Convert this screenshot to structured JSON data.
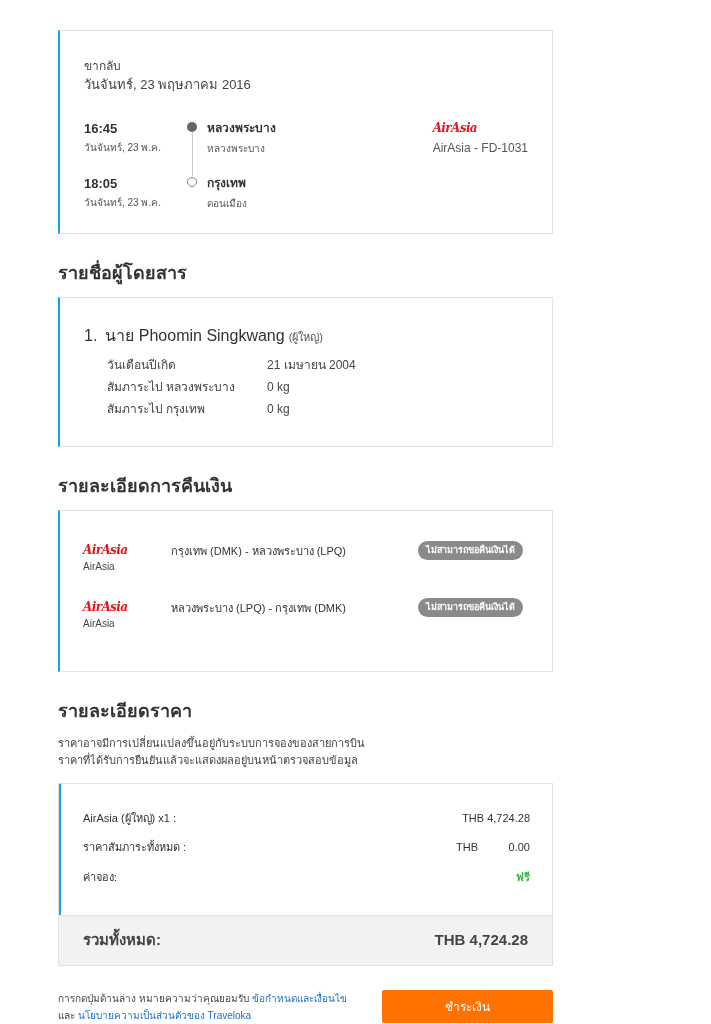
{
  "flight": {
    "direction": "ขากลับ",
    "date": "วันจันทร์, 23 พฤษภาคม 2016",
    "stops": [
      {
        "kind": "departure",
        "time": "16:45",
        "date": "วันจันทร์, 23 พ.ค.",
        "city": "หลวงพระบาง",
        "airport": "หลวงพระบาง"
      },
      {
        "kind": "arrival",
        "time": "18:05",
        "date": "วันจันทร์, 23 พ.ค.",
        "city": "กรุงเทพ",
        "airport": "ดอนเมือง"
      }
    ],
    "airline_logo": "AirAsia",
    "airline": "AirAsia - FD-1031"
  },
  "passengers": {
    "heading": "รายชื่อผู้โดยสาร",
    "items": [
      {
        "number": "1.",
        "name": "นาย Phoomin Singkwang",
        "type": "(ผู้ใหญ่)",
        "details": [
          {
            "label": "วันเดือนปีเกิด",
            "value": "21 เมษายน 2004"
          },
          {
            "label": "สัมภาระไป หลวงพระบาง",
            "value": "0 kg"
          },
          {
            "label": "สัมภาระไป กรุงเทพ",
            "value": "0 kg"
          }
        ]
      }
    ]
  },
  "refund": {
    "heading": "รายละเอียดการคืนเงิน",
    "items": [
      {
        "logo": "AirAsia",
        "airline": "AirAsia",
        "route": "กรุงเทพ (DMK) - หลวงพระบาง (LPQ)",
        "status": "ไม่สามารถขอคืนเงินได้",
        "refundable": false
      },
      {
        "logo": "AirAsia",
        "airline": "AirAsia",
        "route": "หลวงพระบาง (LPQ) - กรุงเทพ (DMK)",
        "status": "ไม่สามารถขอคืนเงินได้",
        "refundable": false
      }
    ]
  },
  "price": {
    "heading": "รายละเอียดราคา",
    "notes": [
      "ราคาอาจมีการเปลี่ยนแปลงขึ้นอยู่กับระบบการจองของสายการบิน",
      "ราคาที่ได้รับการยืนยันแล้วจะแสดงผลอยู่บนหน้าตรวจสอบข้อมูล"
    ],
    "rows": [
      {
        "kind": "amount",
        "label": "AirAsia (ผู้ใหญ่) x1 :",
        "value": "THB 4,724.28"
      },
      {
        "kind": "split",
        "label": "ราคาสัมภาระทั้งหมด :",
        "currency": "THB",
        "amount": "0.00"
      },
      {
        "kind": "free",
        "label": "ค่าจอง:",
        "value": "ฟรี"
      }
    ],
    "total_label": "รวมทั้งหมด:",
    "total": "THB 4,724.28"
  },
  "footer": {
    "text": "การกดปุ่มด้านล่าง หมายความว่าคุณยอมรับ",
    "link1": "ข้อกำหนดและเงื่อนไข",
    "joiner": "และ",
    "link2": "นโยบายความเป็นส่วนตัวของ Traveloka",
    "button": "ชำระเงิน"
  }
}
